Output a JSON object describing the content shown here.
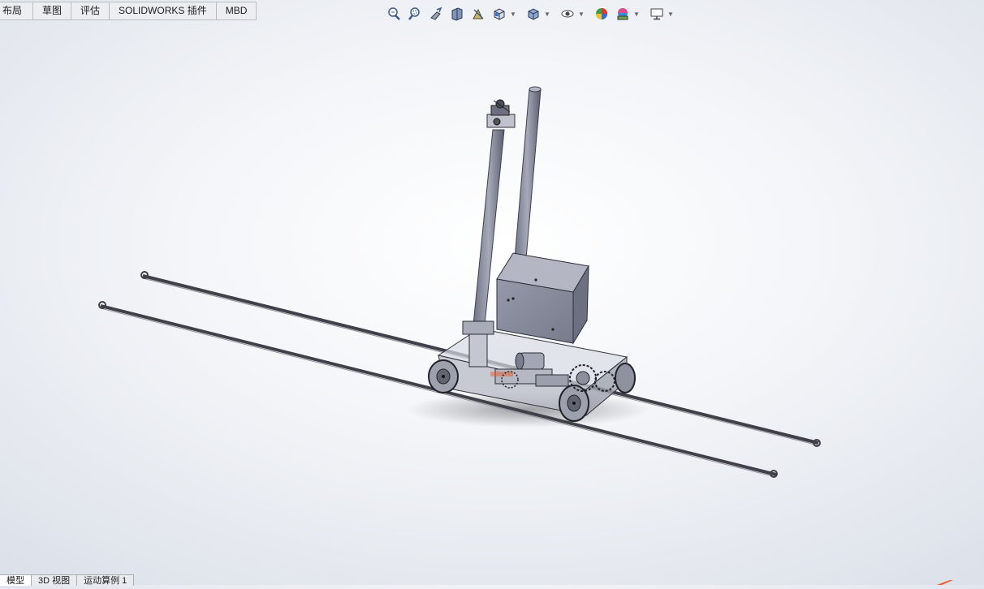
{
  "command_tabs": [
    "布局",
    "草图",
    "评估",
    "SOLIDWORKS 插件",
    "MBD"
  ],
  "toolbar_icons": [
    "zoom-to-fit-icon",
    "zoom-to-area-icon",
    "previous-view-icon",
    "section-view-icon",
    "dynamic-annotation-view-icon",
    "view-orientation-icon",
    "display-style-icon",
    "hide-show-items-icon",
    "edit-appearance-icon",
    "apply-scene-icon",
    "view-settings-icon"
  ],
  "bottom_tabs": [
    "模型",
    "3D 视图",
    "运动算例 1"
  ],
  "colors": {
    "rail": "#4a4b55",
    "metal": "#8f93a3",
    "metal_dark": "#5e6170",
    "glass": "#c9ccd6",
    "accent": "#e8572a"
  }
}
